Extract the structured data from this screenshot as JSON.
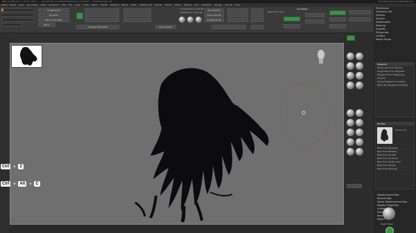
{
  "app": {
    "title": "ZBrush 2022.0.6 - 1.22 Eco Work - ... ActivePoints: 4,113,647 TotalPoints: 4,113,647 ... ProjectLounge Lite",
    "top_right": "SmartSave  Menus  DefaultZScript"
  },
  "menu": [
    "Alpha",
    "Brush",
    "Color",
    "Document",
    "Draw",
    "Dynamics",
    "Edit",
    "File",
    "Layer",
    "Light",
    "Macro",
    "Marker",
    "Material",
    "Movie",
    "Picker",
    "Preferences",
    "Render",
    "Stencil",
    "Stroke",
    "Texture",
    "Tool",
    "Transform",
    "Zplugin",
    "Zscript",
    "Help"
  ],
  "toolbar": {
    "labels": [
      "Sculptris Pro",
      "Dynamic",
      "Mirror And Weld",
      "Mirror",
      "Activate Symmetry",
      "Use Absolute"
    ],
    "points": "ActivePoints: 4.113 Mil",
    "total": "TotalPoints: 4.113 Mil",
    "dynamesh": "DynaMesh",
    "focal_shift": "Focal Shift 0",
    "draw_size": "Draw Size 64",
    "z_intensity": "Z Intensity 25",
    "resolution": "Resolution 128"
  },
  "right_panel": {
    "items": [
      "PolyGroups",
      "Geometry HD",
      "Preview",
      "Surface",
      "Deformation",
      "Masking",
      "Visibility",
      "Polygroups",
      "Contact",
      "Morph Target"
    ],
    "polypaint_header": "Polypaint",
    "polypaint_items": [
      "Polygroups From Texture",
      "Polygroups From Polypaint",
      "Polypaint From Polygroups",
      "Colorize",
      "Set by Polypaint Colorizing",
      "Mirror By Polypaint Colorizing"
    ],
    "texture_header": "UV Map",
    "texture_label": "Texture On",
    "texture_items": [
      "New From Polypaint",
      "New From Masking",
      "New From UV Map",
      "New From UV Check",
      "New From Vertex Color",
      "New From Texture",
      "New From Polymap"
    ],
    "bottom_items": [
      "Displacement Map",
      "Normal Map",
      "Vector Displacement Map",
      "Display Properties",
      "Unified Skin",
      "Initialize",
      "Import",
      "Export"
    ],
    "depth_label": "Depth Mask"
  },
  "hotkeys": {
    "undo": {
      "key1": "Ctrl",
      "plus": "+",
      "key2": "Z"
    },
    "redo": {
      "key1": "Ctrl",
      "plus1": "+",
      "key2": "Alt",
      "plus2": "+",
      "key3": "C"
    }
  },
  "colors": {
    "accent_green": "#3e8f4a",
    "orange": "#c97a2b",
    "viewport": "#6f6f6f"
  }
}
